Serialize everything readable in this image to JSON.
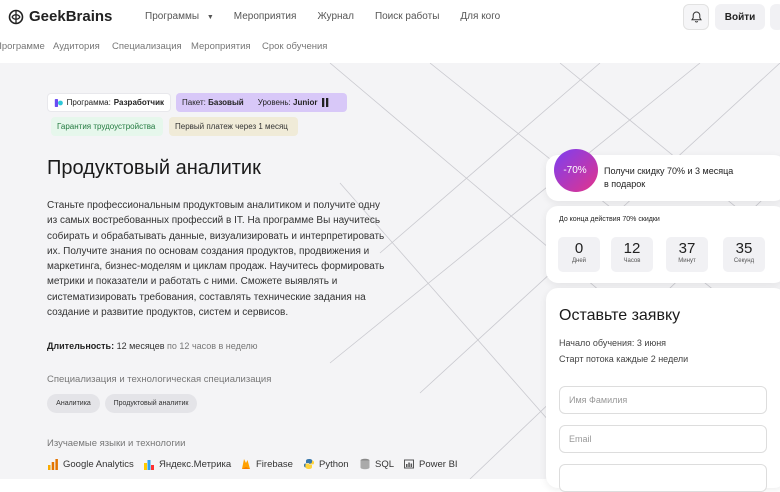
{
  "header": {
    "logo_text": "GeekBrains",
    "nav": [
      {
        "label": "Программы",
        "dropdown": true
      },
      {
        "label": "Мероприятия"
      },
      {
        "label": "Журнал"
      },
      {
        "label": "Поиск работы"
      },
      {
        "label": "Для кого"
      }
    ],
    "login_label": "Войти"
  },
  "subnav": [
    "Программе",
    "Аудитория",
    "Специализация",
    "Мероприятия",
    "Срок обучения"
  ],
  "hero": {
    "pill_program_label": "Программа:",
    "pill_program_value": "Разработчик",
    "pill_package_label": "Пакет:",
    "pill_package_value": "Базовый",
    "pill_level_label": "Уровень:",
    "pill_level_value": "Junior",
    "pill_guarantee": "Гарантия трудоустройства",
    "pill_payment": "Первый платеж через 1 месяц",
    "title": "Продуктовый аналитик",
    "description": "Станьте профессиональным продуктовым аналитиком и получите одну из самых востребованных профессий в IT. На программе Вы научитесь собирать и обрабатывать данные, визуализировать и интерпретировать их. Получите знания по основам создания продуктов, продвижения и маркетинга, бизнес-моделям и циклам продаж. Научитесь формировать метрики и показатели и работать с ними. Сможете выявлять и систематизировать требования, составлять технические задания на создание и развитие продуктов, систем и сервисов.",
    "duration_label": "Длительность:",
    "duration_value": "12 месяцев",
    "duration_rest": "по 12 часов в неделю",
    "spec_title": "Специализация и технологическая специализация",
    "tags": [
      "Аналитика",
      "Продуктовый аналитик"
    ],
    "tech_title": "Изучаемые языки и технологии",
    "tech": [
      "Google Analytics",
      "Яндекс.Метрика",
      "Firebase",
      "Python",
      "SQL",
      "Power BI"
    ]
  },
  "promo": {
    "badge": "-70%",
    "text_line1": "Получи скидку 70% и 3 месяца",
    "text_line2": "в подарок"
  },
  "countdown": {
    "label": "До конца действия 70% скидки",
    "items": [
      {
        "value": "0",
        "unit": "Дней"
      },
      {
        "value": "12",
        "unit": "Часов"
      },
      {
        "value": "37",
        "unit": "Минут"
      },
      {
        "value": "35",
        "unit": "Секунд"
      }
    ]
  },
  "form": {
    "title": "Оставьте заявку",
    "start_label": "Начало обучения:",
    "start_value": "3 июня",
    "stream": "Старт потока каждые 2 недели",
    "name_placeholder": "Имя Фамилия",
    "email_placeholder": "Email"
  },
  "colors": {
    "accent_purple": "#7b3ff2",
    "badge_pink": "#e4338a",
    "package_pill": "#d8c8f8",
    "guarantee_green": "#227a3f"
  }
}
